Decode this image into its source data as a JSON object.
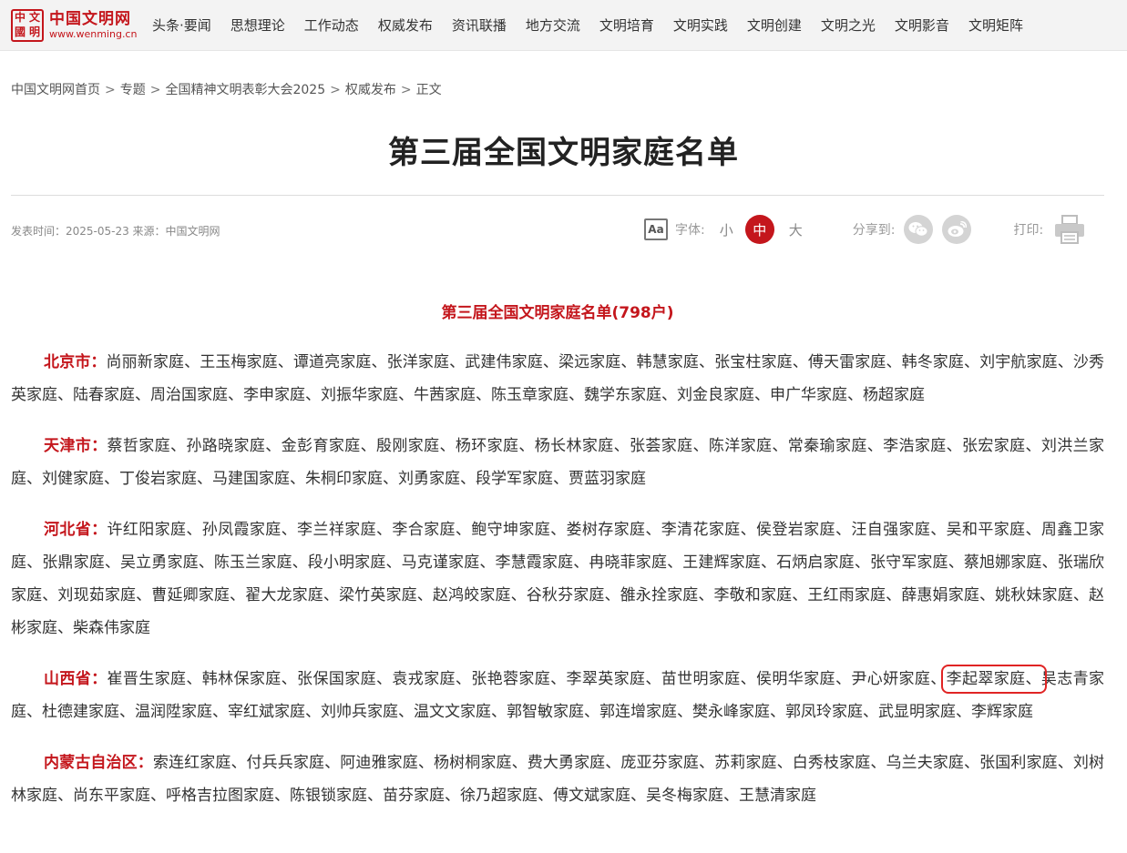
{
  "logo": {
    "seal_chars": [
      "中",
      "文",
      "國",
      "明"
    ],
    "name": "中国文明网",
    "url": "www.wenming.cn"
  },
  "nav": [
    "头条·要闻",
    "思想理论",
    "工作动态",
    "权威发布",
    "资讯联播",
    "地方交流",
    "文明培育",
    "文明实践",
    "文明创建",
    "文明之光",
    "文明影音",
    "文明矩阵"
  ],
  "breadcrumb": [
    "中国文明网首页",
    "专题",
    "全国精神文明表彰大会2025",
    "权威发布",
    "正文"
  ],
  "breadcrumb_sep": ">",
  "title": "第三届全国文明家庭名单",
  "meta": "发表时间：2025-05-23 来源：中国文明网",
  "tools": {
    "font_icon": "Aa",
    "font_label": "字体:",
    "small": "小",
    "medium": "中",
    "large": "大",
    "share_label": "分享到:",
    "print_label": "打印:",
    "icons": [
      "font-size-icon",
      "wechat-icon",
      "weibo-icon",
      "printer-icon"
    ]
  },
  "colors": {
    "accent": "#c4161c",
    "highlight_box": "#e02424"
  },
  "subtitle": "第三届全国文明家庭名单(798户)",
  "provinces": {
    "beijing": {
      "label": "北京市：",
      "text": "尚丽新家庭、王玉梅家庭、谭道亮家庭、张洋家庭、武建伟家庭、梁远家庭、韩慧家庭、张宝柱家庭、傅天雷家庭、韩冬家庭、刘宇航家庭、沙秀英家庭、陆春家庭、周治国家庭、李申家庭、刘振华家庭、牛茜家庭、陈玉章家庭、魏学东家庭、刘金良家庭、申广华家庭、杨超家庭"
    },
    "tianjin": {
      "label": "天津市：",
      "text": "蔡哲家庭、孙路晓家庭、金彭育家庭、殷刚家庭、杨环家庭、杨长林家庭、张荟家庭、陈洋家庭、常秦瑜家庭、李浩家庭、张宏家庭、刘洪兰家庭、刘健家庭、丁俊岩家庭、马建国家庭、朱桐印家庭、刘勇家庭、段学军家庭、贾蓝羽家庭"
    },
    "hebei": {
      "label": "河北省：",
      "text": "许红阳家庭、孙凤霞家庭、李兰祥家庭、李合家庭、鲍守坤家庭、娄树存家庭、李清花家庭、侯登岩家庭、汪自强家庭、吴和平家庭、周鑫卫家庭、张鼎家庭、吴立勇家庭、陈玉兰家庭、段小明家庭、马克谨家庭、李慧霞家庭、冉晓菲家庭、王建辉家庭、石炳启家庭、张守军家庭、蔡旭娜家庭、张瑞欣家庭、刘现茹家庭、曹延卿家庭、翟大龙家庭、梁竹英家庭、赵鸿皎家庭、谷秋芬家庭、雒永拴家庭、李敬和家庭、王红雨家庭、薛惠娟家庭、姚秋妹家庭、赵彬家庭、柴森伟家庭"
    },
    "shanxi": {
      "label": "山西省：",
      "text_before": "崔晋生家庭、韩林保家庭、张保国家庭、袁戎家庭、张艳蓉家庭、李翠英家庭、苗世明家庭、侯明华家庭、尹心妍家庭、",
      "highlight": "李起翠家庭、",
      "text_after": "吴志青家庭、杜德建家庭、温润陞家庭、宰红斌家庭、刘帅兵家庭、温文文家庭、郭智敏家庭、郭连增家庭、樊永峰家庭、郭凤玲家庭、武显明家庭、李辉家庭"
    },
    "neimenggu": {
      "label": "内蒙古自治区：",
      "text": "索连红家庭、付兵兵家庭、阿迪雅家庭、杨树桐家庭、费大勇家庭、庞亚芬家庭、苏莉家庭、白秀枝家庭、乌兰夫家庭、张国利家庭、刘树林家庭、尚东平家庭、呼格吉拉图家庭、陈银锁家庭、苗芬家庭、徐乃超家庭、傅文斌家庭、吴冬梅家庭、王慧清家庭"
    }
  }
}
